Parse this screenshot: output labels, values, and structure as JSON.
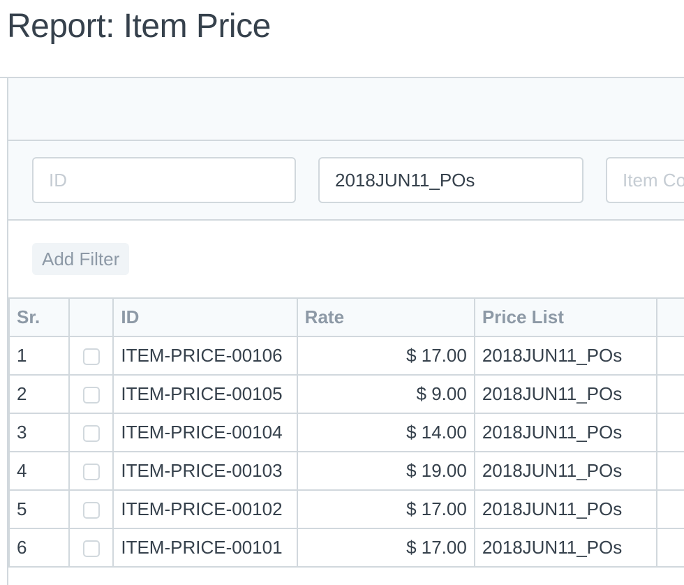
{
  "page": {
    "title": "Report: Item Price"
  },
  "filters": {
    "id_placeholder": "ID",
    "price_list_value": "2018JUN11_POs",
    "item_code_placeholder": "Item Code",
    "add_filter_label": "Add Filter"
  },
  "table": {
    "columns": [
      "Sr.",
      "",
      "ID",
      "Rate",
      "Price List"
    ],
    "rows": [
      {
        "sr": "1",
        "id": "ITEM-PRICE-00106",
        "rate": "$ 17.00",
        "price_list": "2018JUN11_POs"
      },
      {
        "sr": "2",
        "id": "ITEM-PRICE-00105",
        "rate": "$ 9.00",
        "price_list": "2018JUN11_POs"
      },
      {
        "sr": "3",
        "id": "ITEM-PRICE-00104",
        "rate": "$ 14.00",
        "price_list": "2018JUN11_POs"
      },
      {
        "sr": "4",
        "id": "ITEM-PRICE-00103",
        "rate": "$ 19.00",
        "price_list": "2018JUN11_POs"
      },
      {
        "sr": "5",
        "id": "ITEM-PRICE-00102",
        "rate": "$ 17.00",
        "price_list": "2018JUN11_POs"
      },
      {
        "sr": "6",
        "id": "ITEM-PRICE-00101",
        "rate": "$ 17.00",
        "price_list": "2018JUN11_POs"
      }
    ]
  }
}
